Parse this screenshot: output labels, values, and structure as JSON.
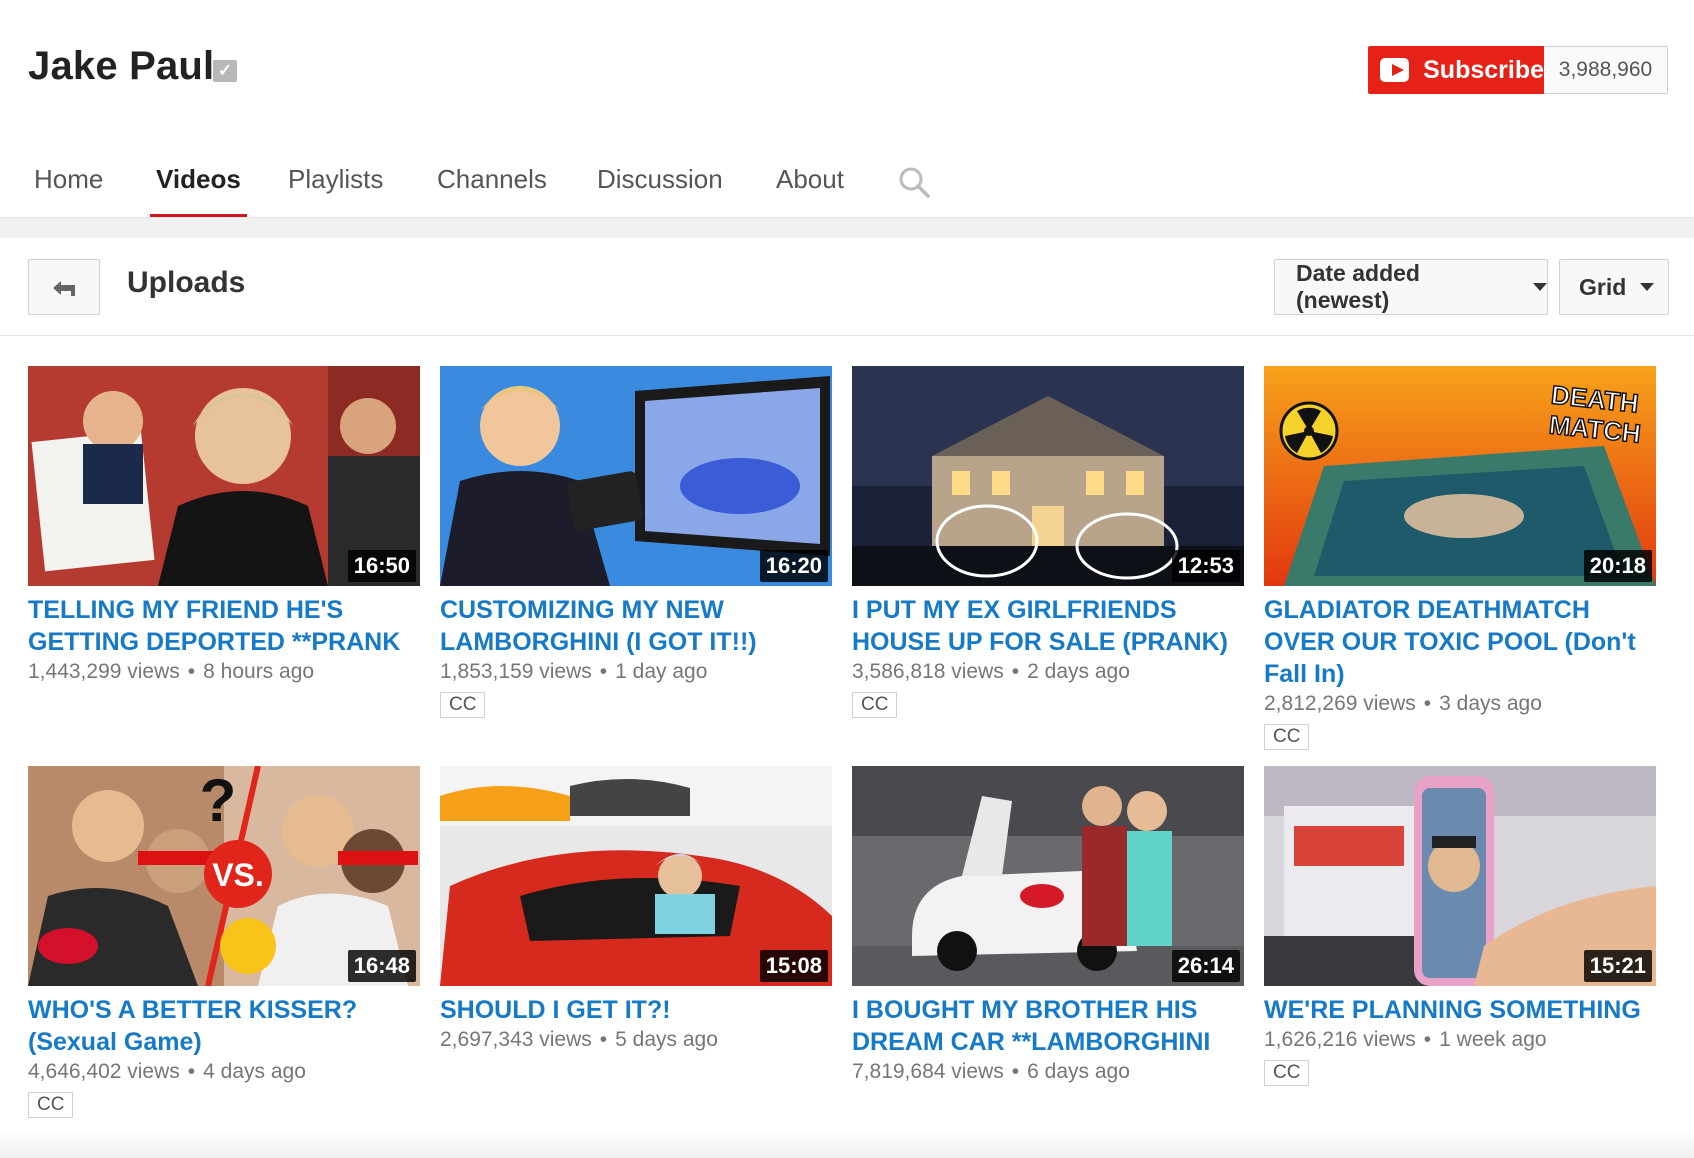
{
  "channel": {
    "name": "Jake Paul",
    "verified_icon": "verified-check-icon",
    "subscribe_label": "Subscribe",
    "subscriber_count": "3,988,960"
  },
  "tabs": [
    {
      "label": "Home"
    },
    {
      "label": "Videos"
    },
    {
      "label": "Playlists"
    },
    {
      "label": "Channels"
    },
    {
      "label": "Discussion"
    },
    {
      "label": "About"
    }
  ],
  "active_tab": "Videos",
  "section": {
    "title": "Uploads",
    "sort_label": "Date added (newest)",
    "view_label": "Grid"
  },
  "videos": [
    {
      "title": "TELLING MY FRIEND HE'S GETTING DEPORTED **PRANK",
      "views": "1,443,299 views",
      "age": "8 hours ago",
      "duration": "16:50",
      "cc": ""
    },
    {
      "title": "CUSTOMIZING MY NEW LAMBORGHINI (I GOT IT!!)",
      "views": "1,853,159 views",
      "age": "1 day ago",
      "duration": "16:20",
      "cc": "CC"
    },
    {
      "title": "I PUT MY EX GIRLFRIENDS HOUSE UP FOR SALE (PRANK)",
      "views": "3,586,818 views",
      "age": "2 days ago",
      "duration": "12:53",
      "cc": "CC"
    },
    {
      "title": "GLADIATOR DEATHMATCH OVER OUR TOXIC POOL (Don't Fall In)",
      "views": "2,812,269 views",
      "age": "3 days ago",
      "duration": "20:18",
      "cc": "CC",
      "thumb_text_1": "DEATH",
      "thumb_text_2": "MATCH"
    },
    {
      "title": "WHO'S A BETTER KISSER? (Sexual Game)",
      "views": "4,646,402 views",
      "age": "4 days ago",
      "duration": "16:48",
      "cc": "CC",
      "thumb_text_1": "?",
      "thumb_text_2": "VS."
    },
    {
      "title": "SHOULD I GET IT?!",
      "views": "2,697,343 views",
      "age": "5 days ago",
      "duration": "15:08",
      "cc": ""
    },
    {
      "title": "I BOUGHT MY BROTHER HIS DREAM CAR **LAMBORGHINI",
      "views": "7,819,684 views",
      "age": "6 days ago",
      "duration": "26:14",
      "cc": ""
    },
    {
      "title": "WE'RE PLANNING SOMETHING",
      "views": "1,626,216 views",
      "age": "1 week ago",
      "duration": "15:21",
      "cc": "CC"
    }
  ],
  "meta_separator": "•",
  "colors": {
    "subscribe_red": "#e62117",
    "tab_underline": "#cc181e",
    "title_blue": "#167ac6"
  }
}
